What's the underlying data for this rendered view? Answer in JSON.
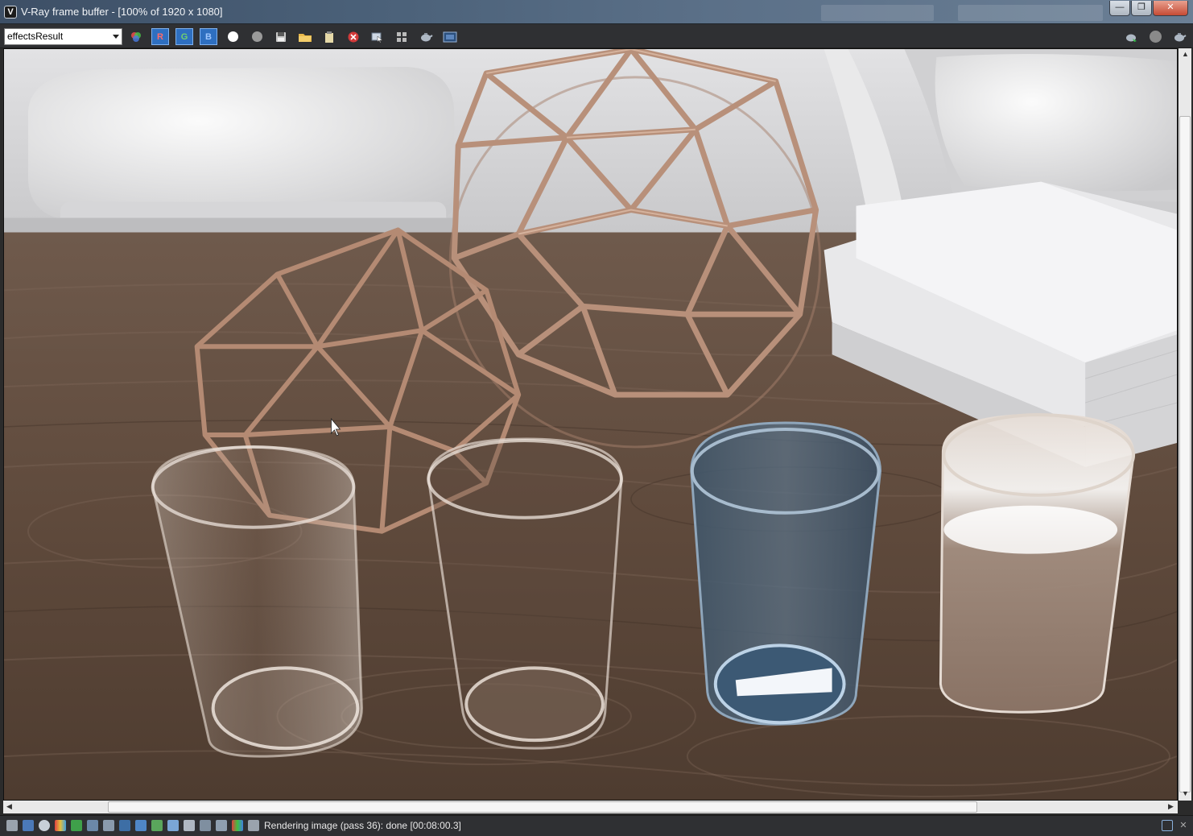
{
  "window": {
    "title": "V-Ray frame buffer - [100% of 1920 x 1080]",
    "app_icon": "V",
    "controls": {
      "minimize": "—",
      "maximize": "❐",
      "close": "✕"
    }
  },
  "toolbar": {
    "channel_value": "effectsResult",
    "buttons": [
      {
        "name": "color-channels-icon"
      },
      {
        "name": "red-channel-button",
        "label": "R"
      },
      {
        "name": "green-channel-button",
        "label": "G"
      },
      {
        "name": "blue-channel-button",
        "label": "B"
      },
      {
        "name": "alpha-white-icon"
      },
      {
        "name": "monochrome-icon"
      },
      {
        "name": "save-icon"
      },
      {
        "name": "open-folder-icon"
      },
      {
        "name": "clear-image-icon"
      },
      {
        "name": "stop-render-icon"
      },
      {
        "name": "track-mouse-icon"
      },
      {
        "name": "region-render-icon"
      },
      {
        "name": "render-teapot-icon"
      },
      {
        "name": "vfb-history-icon"
      }
    ],
    "right_buttons": [
      {
        "name": "interactive-render-icon"
      },
      {
        "name": "stop-icon"
      },
      {
        "name": "render-icon"
      }
    ]
  },
  "colors": {
    "toolbar_bg": "#2f3033",
    "active_button": "#2e6fc0",
    "status_text": "#e8e8e8"
  },
  "statusbar": {
    "message": "Rendering image (pass 36): done [00:08:00.3]"
  }
}
